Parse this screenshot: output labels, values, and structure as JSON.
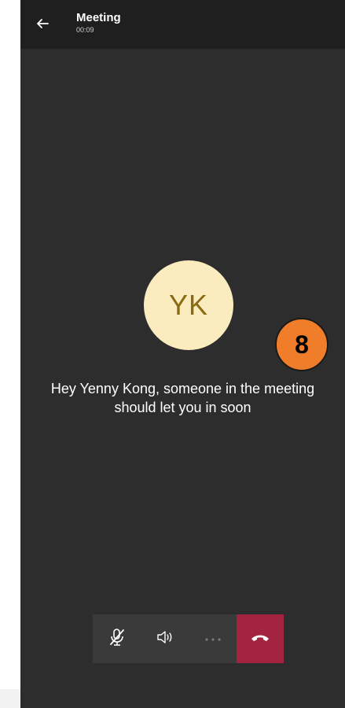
{
  "header": {
    "title": "Meeting",
    "timer": "00:09"
  },
  "avatar": {
    "initials": "YK"
  },
  "message": {
    "line1": "Hey Yenny Kong, someone in the meeting",
    "line2": "should let you in soon"
  },
  "badge": {
    "label": "8"
  },
  "colors": {
    "background": "#2d2d2d",
    "topbar": "#1f1f1f",
    "avatar_bg": "#fbecc0",
    "avatar_text": "#8a6a12",
    "hangup": "#a3243f",
    "badge": "#f07d2a"
  },
  "controls": {
    "items": [
      "mic-off-icon",
      "speaker-icon",
      "more-icon",
      "hang-up-icon"
    ]
  }
}
